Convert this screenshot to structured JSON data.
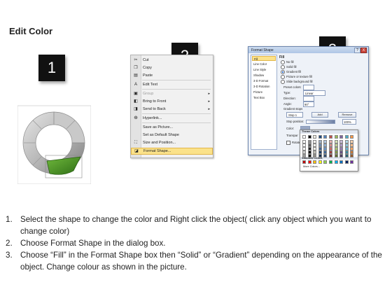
{
  "title": "Edit Color",
  "steps": {
    "badge1": "1",
    "badge2": "2",
    "badge3": "3"
  },
  "colors": {
    "ring_gray": "#b8b8b8",
    "ring_green": "#3f8a1f",
    "badge_bg": "#111111",
    "menu_highlight": "#fbe28a",
    "dialog_border": "#6b84ad"
  },
  "context_menu": {
    "items": [
      {
        "icon": "scissors-icon",
        "label": "Cut"
      },
      {
        "icon": "copy-icon",
        "label": "Copy"
      },
      {
        "icon": "paste-icon",
        "label": "Paste"
      },
      {
        "icon": "edit-text-icon",
        "label": "Edit Text"
      },
      {
        "icon": "group-icon",
        "label": "Group"
      },
      {
        "icon": "bring-front-icon",
        "label": "Bring to Front"
      },
      {
        "icon": "send-back-icon",
        "label": "Send to Back"
      },
      {
        "icon": "hyperlink-icon",
        "label": "Hyperlink..."
      },
      {
        "icon": "",
        "label": "Save as Picture..."
      },
      {
        "icon": "",
        "label": "Set as Default Shape"
      },
      {
        "icon": "size-icon",
        "label": "Size and Position..."
      },
      {
        "icon": "format-shape-icon",
        "label": "Format Shape..."
      }
    ]
  },
  "dialog": {
    "title": "Format Shape",
    "help": "?",
    "close": "X",
    "categories": [
      "Fill",
      "Line Color",
      "Line Style",
      "Shadow",
      "3-D Format",
      "3-D Rotation",
      "Picture",
      "Text Box"
    ],
    "fill_heading": "Fill",
    "options": [
      "No fill",
      "Solid fill",
      "Gradient fill",
      "Picture or texture fill",
      "Slide background fill"
    ],
    "preset_colors_label": "Preset colors:",
    "type_label": "Type:",
    "type_value": "Linear",
    "direction_label": "Direction:",
    "angle_label": "Angle:",
    "angle_value": "90°",
    "gradient_stops_label": "Gradient stops",
    "stop_value": "Stop 1",
    "add_label": "Add",
    "remove_label": "Remove",
    "stop_position_label": "Stop position:",
    "stop_position_value": "100%",
    "color_label": "Color:",
    "transparency_label": "Transpar",
    "rotate_label": "Rotate"
  },
  "palette": {
    "theme_heading": "Theme Colors",
    "standard_heading": "Standard Colors",
    "more_colors": "More Colors...",
    "theme_columns": [
      "#ffffff",
      "#000000",
      "#eeece1",
      "#1f497d",
      "#4f81bd",
      "#c0504d",
      "#9bbb59",
      "#8064a2",
      "#4bacc6",
      "#f79646"
    ],
    "standard": [
      "#c00000",
      "#ff0000",
      "#ffc000",
      "#ffff00",
      "#92d050",
      "#00b050",
      "#00b0f0",
      "#0070c0",
      "#002060",
      "#7030a0"
    ]
  },
  "instructions": [
    {
      "num": "1.",
      "text": "Select the shape to change the color and Right click the object( click any object which you want to change color)"
    },
    {
      "num": "2.",
      "text": "Choose Format Shape in the dialog box."
    },
    {
      "num": "3.",
      "text": "Choose “Fill” in the Format Shape box then “Solid” or “Gradient” depending on the appearance of the object. Change colour as shown in the picture."
    }
  ]
}
